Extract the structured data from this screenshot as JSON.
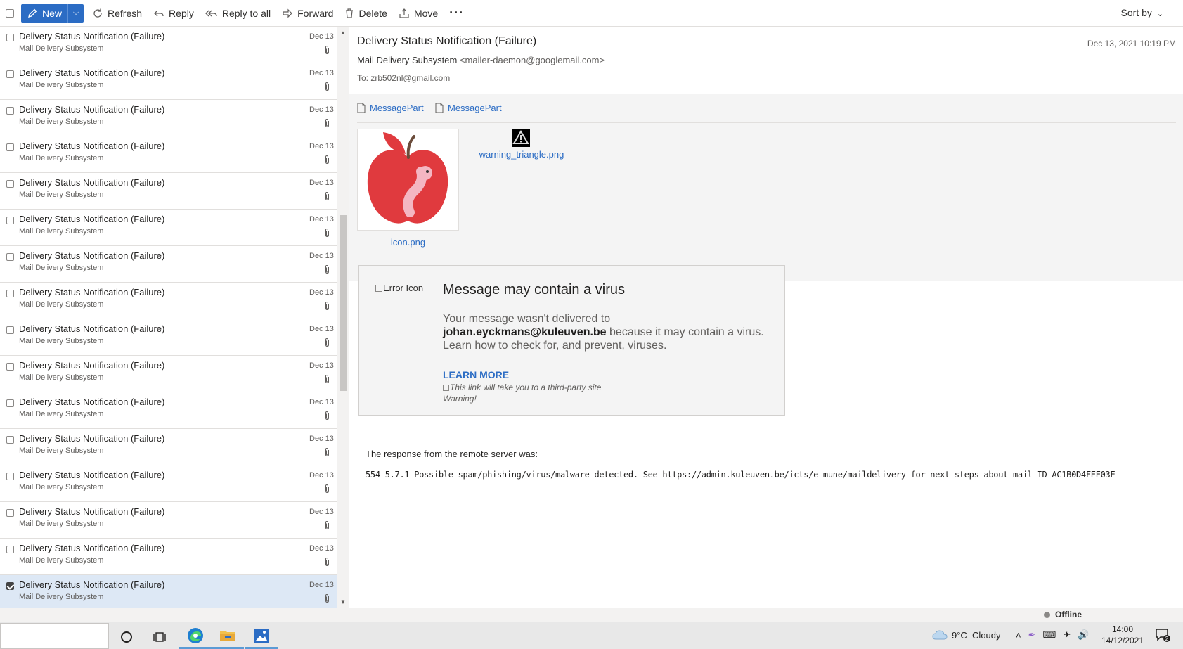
{
  "toolbar": {
    "new_label": "New",
    "refresh_label": "Refresh",
    "reply_label": "Reply",
    "reply_all_label": "Reply to all",
    "forward_label": "Forward",
    "delete_label": "Delete",
    "move_label": "Move",
    "more_label": "···",
    "sort_label": "Sort by"
  },
  "messages": [
    {
      "subject": "Delivery Status Notification (Failure)",
      "sender": "Mail Delivery Subsystem",
      "date": "Dec 13"
    },
    {
      "subject": "Delivery Status Notification (Failure)",
      "sender": "Mail Delivery Subsystem",
      "date": "Dec 13"
    },
    {
      "subject": "Delivery Status Notification (Failure)",
      "sender": "Mail Delivery Subsystem",
      "date": "Dec 13"
    },
    {
      "subject": "Delivery Status Notification (Failure)",
      "sender": "Mail Delivery Subsystem",
      "date": "Dec 13"
    },
    {
      "subject": "Delivery Status Notification (Failure)",
      "sender": "Mail Delivery Subsystem",
      "date": "Dec 13"
    },
    {
      "subject": "Delivery Status Notification (Failure)",
      "sender": "Mail Delivery Subsystem",
      "date": "Dec 13"
    },
    {
      "subject": "Delivery Status Notification (Failure)",
      "sender": "Mail Delivery Subsystem",
      "date": "Dec 13"
    },
    {
      "subject": "Delivery Status Notification (Failure)",
      "sender": "Mail Delivery Subsystem",
      "date": "Dec 13"
    },
    {
      "subject": "Delivery Status Notification (Failure)",
      "sender": "Mail Delivery Subsystem",
      "date": "Dec 13"
    },
    {
      "subject": "Delivery Status Notification (Failure)",
      "sender": "Mail Delivery Subsystem",
      "date": "Dec 13"
    },
    {
      "subject": "Delivery Status Notification (Failure)",
      "sender": "Mail Delivery Subsystem",
      "date": "Dec 13"
    },
    {
      "subject": "Delivery Status Notification (Failure)",
      "sender": "Mail Delivery Subsystem",
      "date": "Dec 13"
    },
    {
      "subject": "Delivery Status Notification (Failure)",
      "sender": "Mail Delivery Subsystem",
      "date": "Dec 13"
    },
    {
      "subject": "Delivery Status Notification (Failure)",
      "sender": "Mail Delivery Subsystem",
      "date": "Dec 13"
    },
    {
      "subject": "Delivery Status Notification (Failure)",
      "sender": "Mail Delivery Subsystem",
      "date": "Dec 13"
    },
    {
      "subject": "Delivery Status Notification (Failure)",
      "sender": "Mail Delivery Subsystem",
      "date": "Dec 13",
      "selected": true
    }
  ],
  "reading": {
    "subject": "Delivery Status Notification (Failure)",
    "date": "Dec 13, 2021 10:19 PM",
    "from_name": "Mail Delivery Subsystem",
    "from_email": "<mailer-daemon@googlemail.com>",
    "to": "To: zrb502nl@gmail.com",
    "attachments": [
      "MessagePart",
      "MessagePart"
    ],
    "icon_label": "icon.png",
    "warning_label": "warning_triangle.png"
  },
  "virus_notice": {
    "error_icon_alt": "Error Icon",
    "title": "Message may contain a virus",
    "text_before": "Your message wasn't delivered to ",
    "recipient": "johan.eyckmans@kuleuven.be",
    "text_after": " because it may contain a virus. Learn how to check for, and prevent, viruses.",
    "learn_more": "LEARN MORE",
    "third_party_alt": "This link will take you to a third-party site",
    "warning_alt": "Warning!"
  },
  "response": {
    "label": "The response from the remote server was:",
    "text": "554 5.7.1 Possible spam/phishing/virus/malware detected. See https://admin.kuleuven.be/icts/e-mune/maildelivery for next steps about mail ID AC1B0D4FEE03E"
  },
  "status": {
    "offline": "Offline"
  },
  "taskbar": {
    "weather": "9°C  Cloudy",
    "time": "14:00",
    "date": "14/12/2021",
    "notification_count": "2"
  },
  "colors": {
    "accent": "#2b6cc4",
    "selected_row": "#dde8f5",
    "apple_red": "#e03a3e"
  }
}
